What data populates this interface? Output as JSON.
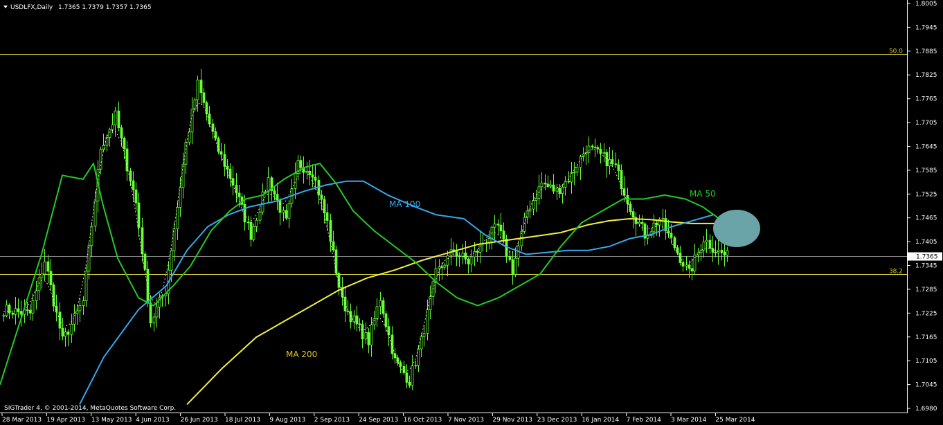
{
  "chart_data": {
    "type": "candlestick",
    "header": {
      "symbol": "USDLFX,Daily",
      "ohlc": "1.7365 1.7379 1.7357 1.7365",
      "copyright": "SIGTrader 4, © 2001-2014, MetaQuotes Software Corp."
    },
    "ylim": [
      1.698,
      1.8005
    ],
    "y_ticks": [
      "1.8005",
      "1.7945",
      "1.7885",
      "1.7825",
      "1.7765",
      "1.7705",
      "1.7645",
      "1.7585",
      "1.7525",
      "1.7465",
      "1.7405",
      "1.7345",
      "1.7285",
      "1.7225",
      "1.7165",
      "1.7105",
      "1.7045",
      "1.6980"
    ],
    "x_ticks": [
      "28 Mar 2013",
      "19 Apr 2013",
      "13 May 2013",
      "4 Jun 2013",
      "26 Jun 2013",
      "18 Jul 2013",
      "9 Aug 2013",
      "2 Sep 2013",
      "24 Sep 2013",
      "16 Oct 2013",
      "7 Nov 2013",
      "29 Nov 2013",
      "23 Dec 2013",
      "16 Jan 2014",
      "7 Feb 2014",
      "3 Mar 2014",
      "25 Mar 2014"
    ],
    "current_price": "1.7365",
    "hlines": [
      {
        "label": "50.0",
        "value": 1.7877
      },
      {
        "label": "38.2",
        "value": 1.732
      }
    ],
    "ma_labels": [
      {
        "name": "MA 50",
        "color": "#22cc22"
      },
      {
        "name": "MA 100",
        "color": "#33aaee"
      },
      {
        "name": "MA 200",
        "color": "#e8c820"
      }
    ],
    "colors": {
      "background": "#000000",
      "candles": "#66ff33",
      "axis": "#ffffff",
      "hline": "#d8d030",
      "price_line": "#888888",
      "ma50": "#22cc22",
      "ma100": "#33aaee",
      "ma200": "#f0f040",
      "dotted": "#ffffff",
      "ellipse": "#6aa3a8"
    },
    "anchors": [
      [
        0,
        1.723
      ],
      [
        9,
        1.722
      ],
      [
        14,
        1.7355
      ],
      [
        20,
        1.715
      ],
      [
        27,
        1.725
      ],
      [
        33,
        1.764
      ],
      [
        38,
        1.772
      ],
      [
        45,
        1.75
      ],
      [
        50,
        1.72
      ],
      [
        55,
        1.728
      ],
      [
        62,
        1.765
      ],
      [
        66,
        1.78
      ],
      [
        72,
        1.765
      ],
      [
        78,
        1.755
      ],
      [
        84,
        1.742
      ],
      [
        90,
        1.756
      ],
      [
        96,
        1.745
      ],
      [
        100,
        1.76
      ],
      [
        105,
        1.758
      ],
      [
        110,
        1.745
      ],
      [
        115,
        1.725
      ],
      [
        120,
        1.719
      ],
      [
        124,
        1.715
      ],
      [
        128,
        1.726
      ],
      [
        133,
        1.71
      ],
      [
        138,
        1.705
      ],
      [
        142,
        1.715
      ],
      [
        147,
        1.732
      ],
      [
        153,
        1.738
      ],
      [
        158,
        1.735
      ],
      [
        163,
        1.74
      ],
      [
        168,
        1.744
      ],
      [
        173,
        1.733
      ],
      [
        178,
        1.748
      ],
      [
        183,
        1.755
      ],
      [
        188,
        1.753
      ],
      [
        193,
        1.757
      ],
      [
        198,
        1.764
      ],
      [
        203,
        1.762
      ],
      [
        208,
        1.759
      ],
      [
        213,
        1.749
      ],
      [
        218,
        1.742
      ],
      [
        223,
        1.746
      ],
      [
        228,
        1.739
      ],
      [
        233,
        1.732
      ],
      [
        238,
        1.741
      ],
      [
        242,
        1.738
      ],
      [
        246,
        1.7365
      ]
    ],
    "ma50": [
      [
        0,
        1.704
      ],
      [
        60,
        1.737
      ],
      [
        90,
        1.757
      ],
      [
        120,
        1.756
      ],
      [
        135,
        1.76
      ],
      [
        148,
        1.75
      ],
      [
        170,
        1.736
      ],
      [
        200,
        1.726
      ],
      [
        222,
        1.724
      ],
      [
        250,
        1.729
      ],
      [
        275,
        1.734
      ],
      [
        305,
        1.743
      ],
      [
        332,
        1.748
      ],
      [
        355,
        1.751
      ],
      [
        380,
        1.752
      ],
      [
        410,
        1.756
      ],
      [
        440,
        1.759
      ],
      [
        462,
        1.76
      ],
      [
        485,
        1.755
      ],
      [
        510,
        1.748
      ],
      [
        540,
        1.743
      ],
      [
        570,
        1.739
      ],
      [
        600,
        1.735
      ],
      [
        630,
        1.73
      ],
      [
        660,
        1.726
      ],
      [
        690,
        1.724
      ],
      [
        720,
        1.726
      ],
      [
        750,
        1.729
      ],
      [
        780,
        1.732
      ],
      [
        810,
        1.739
      ],
      [
        840,
        1.745
      ],
      [
        870,
        1.748
      ],
      [
        900,
        1.751
      ],
      [
        930,
        1.751
      ],
      [
        960,
        1.752
      ],
      [
        990,
        1.751
      ],
      [
        1015,
        1.749
      ],
      [
        1035,
        1.7465
      ],
      [
        1048,
        1.7445
      ]
    ],
    "ma100": [
      [
        115,
        1.699
      ],
      [
        150,
        1.711
      ],
      [
        200,
        1.723
      ],
      [
        240,
        1.729
      ],
      [
        270,
        1.738
      ],
      [
        300,
        1.744
      ],
      [
        330,
        1.747
      ],
      [
        360,
        1.749
      ],
      [
        400,
        1.7505
      ],
      [
        440,
        1.753
      ],
      [
        470,
        1.7545
      ],
      [
        500,
        1.7555
      ],
      [
        525,
        1.7555
      ],
      [
        560,
        1.752
      ],
      [
        600,
        1.749
      ],
      [
        630,
        1.747
      ],
      [
        670,
        1.746
      ],
      [
        700,
        1.742
      ],
      [
        730,
        1.739
      ],
      [
        760,
        1.737
      ],
      [
        790,
        1.7375
      ],
      [
        820,
        1.738
      ],
      [
        850,
        1.738
      ],
      [
        880,
        1.739
      ],
      [
        910,
        1.741
      ],
      [
        940,
        1.742
      ],
      [
        970,
        1.744
      ],
      [
        1000,
        1.7455
      ],
      [
        1030,
        1.747
      ]
    ],
    "ma200": [
      [
        270,
        1.699
      ],
      [
        320,
        1.708
      ],
      [
        370,
        1.716
      ],
      [
        410,
        1.72
      ],
      [
        450,
        1.724
      ],
      [
        490,
        1.728
      ],
      [
        530,
        1.731
      ],
      [
        570,
        1.733
      ],
      [
        610,
        1.7355
      ],
      [
        650,
        1.7375
      ],
      [
        690,
        1.7395
      ],
      [
        730,
        1.7405
      ],
      [
        770,
        1.7415
      ],
      [
        810,
        1.7425
      ],
      [
        850,
        1.7445
      ],
      [
        880,
        1.7455
      ],
      [
        910,
        1.746
      ],
      [
        940,
        1.7458
      ],
      [
        970,
        1.7452
      ],
      [
        1000,
        1.7448
      ],
      [
        1030,
        1.7448
      ],
      [
        1048,
        1.7445
      ]
    ]
  }
}
